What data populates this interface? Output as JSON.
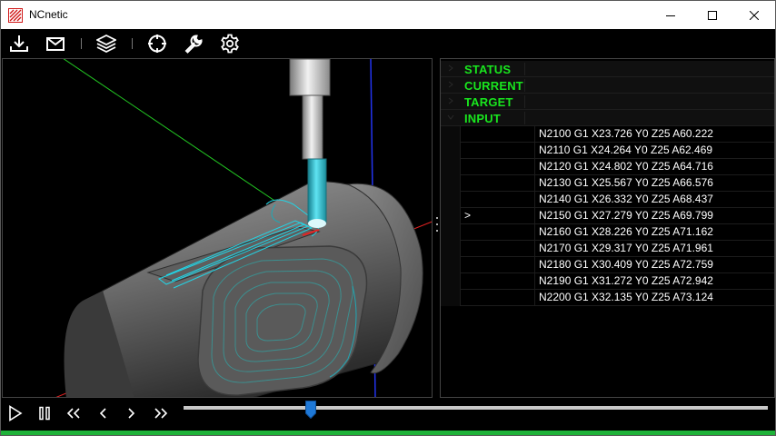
{
  "window": {
    "title": "NCnetic",
    "controls": {
      "minimize": "minimize-icon",
      "maximize": "maximize-icon",
      "close": "close-icon"
    }
  },
  "toolbar": {
    "buttons": [
      {
        "name": "download-button",
        "icon": "download-icon"
      },
      {
        "name": "mail-button",
        "icon": "mail-icon"
      },
      {
        "name": "layers-button",
        "icon": "layers-icon"
      },
      {
        "name": "crosshair-button",
        "icon": "crosshair-icon"
      },
      {
        "name": "wrench-button",
        "icon": "wrench-icon"
      },
      {
        "name": "settings-button",
        "icon": "gear-icon"
      }
    ]
  },
  "panel": {
    "sections": [
      {
        "label": "STATUS",
        "expanded": false
      },
      {
        "label": "CURRENT",
        "expanded": false
      },
      {
        "label": "TARGET",
        "expanded": false
      },
      {
        "label": "INPUT",
        "expanded": true
      }
    ],
    "input_rows": [
      {
        "marker": "",
        "line": "N2100 G1 X23.726 Y0 Z25 A60.222"
      },
      {
        "marker": "",
        "line": "N2110 G1 X24.264 Y0 Z25 A62.469"
      },
      {
        "marker": "",
        "line": "N2120 G1 X24.802 Y0 Z25 A64.716"
      },
      {
        "marker": "",
        "line": "N2130 G1 X25.567 Y0 Z25 A66.576"
      },
      {
        "marker": "",
        "line": "N2140 G1 X26.332 Y0 Z25 A68.437"
      },
      {
        "marker": ">",
        "line": "N2150 G1 X27.279 Y0 Z25 A69.799"
      },
      {
        "marker": "",
        "line": "N2160 G1 X28.226 Y0 Z25 A71.162"
      },
      {
        "marker": "",
        "line": "N2170 G1 X29.317 Y0 Z25 A71.961"
      },
      {
        "marker": "",
        "line": "N2180 G1 X30.409 Y0 Z25 A72.759"
      },
      {
        "marker": "",
        "line": "N2190 G1 X31.272 Y0 Z25 A72.942"
      },
      {
        "marker": "",
        "line": "N2200 G1 X32.135 Y0 Z25 A73.124"
      }
    ]
  },
  "playback": {
    "buttons": [
      {
        "name": "play-button",
        "icon": "play-icon"
      },
      {
        "name": "pause-button",
        "icon": "pause-icon"
      },
      {
        "name": "rewind-button",
        "icon": "double-chevron-left-icon"
      },
      {
        "name": "step-back-button",
        "icon": "chevron-left-icon"
      },
      {
        "name": "step-forward-button",
        "icon": "chevron-right-icon"
      },
      {
        "name": "fast-forward-button",
        "icon": "double-chevron-right-icon"
      }
    ],
    "progress": 0.218
  },
  "colors": {
    "section_label": "#19e61e",
    "status_bar": "#1fb239",
    "slider_thumb": "#1e78d7",
    "tool_shank": "#2bb7c9",
    "toolpath": "#22d5e6",
    "axis_x": "#e62222",
    "axis_y": "#22c422",
    "axis_z": "#2233ee"
  }
}
